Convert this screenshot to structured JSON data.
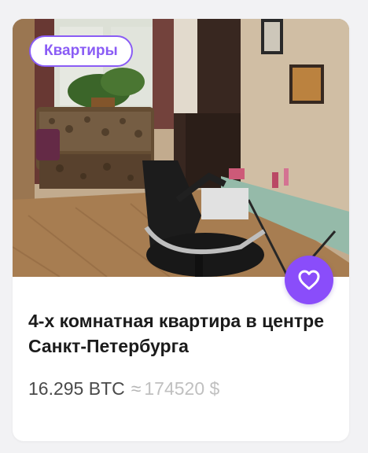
{
  "listing": {
    "category": "Квартиры",
    "title": "4-х комнатная квартира в центре Санкт-Петербурга",
    "price_btc": "16.295 BTC",
    "approx_symbol": "≈",
    "price_usd": "174520 $",
    "photo_icon": "room-photo",
    "favorite_icon": "heart-icon"
  },
  "colors": {
    "accent": "#8a5cf5",
    "favorite_bg": "#8a4dfa",
    "title": "#1b1b1b",
    "price": "#4a4a4a",
    "price_secondary": "#c0c0c0"
  }
}
